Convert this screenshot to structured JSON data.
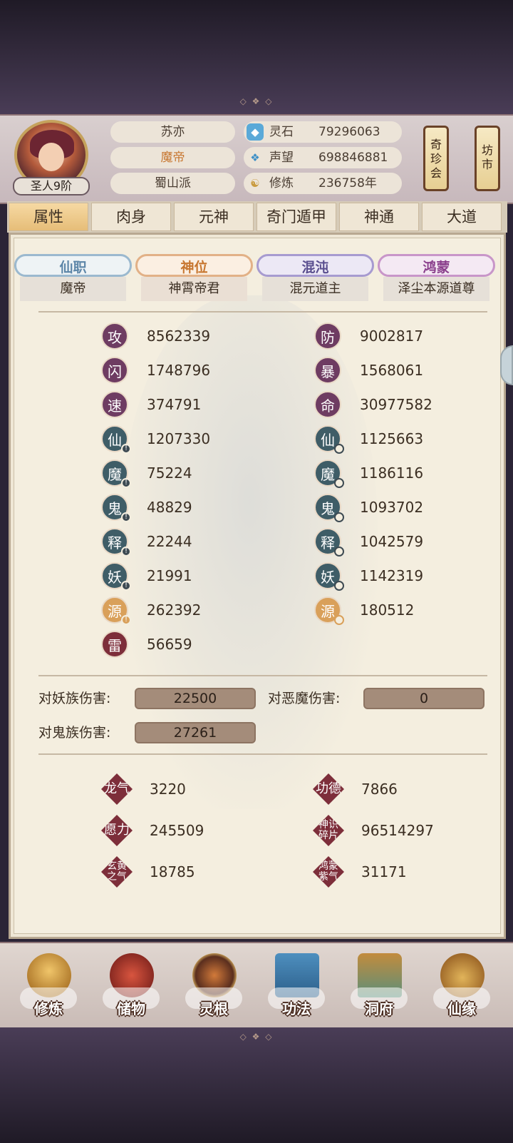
{
  "header": {
    "avatar_rank": "圣人9阶",
    "name": "苏亦",
    "title": "魔帝",
    "sect": "蜀山派",
    "resources": [
      {
        "icon": "spirit-stone-icon",
        "label": "灵石",
        "value": "79296063"
      },
      {
        "icon": "reputation-icon",
        "label": "声望",
        "value": "698846881"
      },
      {
        "icon": "cultivation-icon",
        "label": "修炼",
        "value": "236758年"
      }
    ],
    "lanterns": [
      "奇珍会",
      "坊市"
    ]
  },
  "tabs": [
    "属性",
    "肉身",
    "元神",
    "奇门遁甲",
    "神通",
    "大道"
  ],
  "ranks": [
    {
      "head": "仙职",
      "value": "魔帝",
      "color": "#5d86a8"
    },
    {
      "head": "神位",
      "value": "神霄帝君",
      "color": "#c7762f"
    },
    {
      "head": "混沌",
      "value": "混元道主",
      "color": "#5a4f8f"
    },
    {
      "head": "鸿蒙",
      "value": "泽尘本源道尊",
      "color": "#8a3f8c"
    }
  ],
  "stats_left": [
    {
      "icon": "攻",
      "value": "8562339"
    },
    {
      "icon": "闪",
      "value": "1748796"
    },
    {
      "icon": "速",
      "value": "374791"
    },
    {
      "icon": "仙",
      "value": "1207330"
    },
    {
      "icon": "魔",
      "value": "75224"
    },
    {
      "icon": "鬼",
      "value": "48829"
    },
    {
      "icon": "释",
      "value": "22244"
    },
    {
      "icon": "妖",
      "value": "21991"
    },
    {
      "icon": "源",
      "value": "262392"
    },
    {
      "icon": "雷",
      "value": "56659"
    }
  ],
  "stats_right": [
    {
      "icon": "防",
      "value": "9002817"
    },
    {
      "icon": "暴",
      "value": "1568061"
    },
    {
      "icon": "命",
      "value": "30977582"
    },
    {
      "icon": "仙",
      "value": "1125663"
    },
    {
      "icon": "魔",
      "value": "1186116"
    },
    {
      "icon": "鬼",
      "value": "1093702"
    },
    {
      "icon": "释",
      "value": "1042579"
    },
    {
      "icon": "妖",
      "value": "1142319"
    },
    {
      "icon": "源",
      "value": "180512"
    }
  ],
  "damage": [
    {
      "label": "对妖族伤害:",
      "value": "22500"
    },
    {
      "label": "对恶魔伤害:",
      "value": "0"
    },
    {
      "label": "对鬼族伤害:",
      "value": "27261"
    }
  ],
  "extras": [
    {
      "icon": "龙气",
      "value": "3220"
    },
    {
      "icon": "功德",
      "value": "7866"
    },
    {
      "icon": "愿力",
      "value": "245509"
    },
    {
      "icon": "神识碎片",
      "value": "96514297"
    },
    {
      "icon": "玄黄之气",
      "value": "18785"
    },
    {
      "icon": "鸿蒙紫气",
      "value": "31171"
    }
  ],
  "bottom_nav": [
    "修炼",
    "储物",
    "灵根",
    "功法",
    "洞府",
    "仙缘"
  ],
  "colors": {
    "accent_gold": "#c5a25c",
    "stat_purple": "#6e3c62",
    "stat_teal": "#3f5d67",
    "stat_gold": "#d9a05a",
    "extra_red": "#7d2e3a"
  }
}
